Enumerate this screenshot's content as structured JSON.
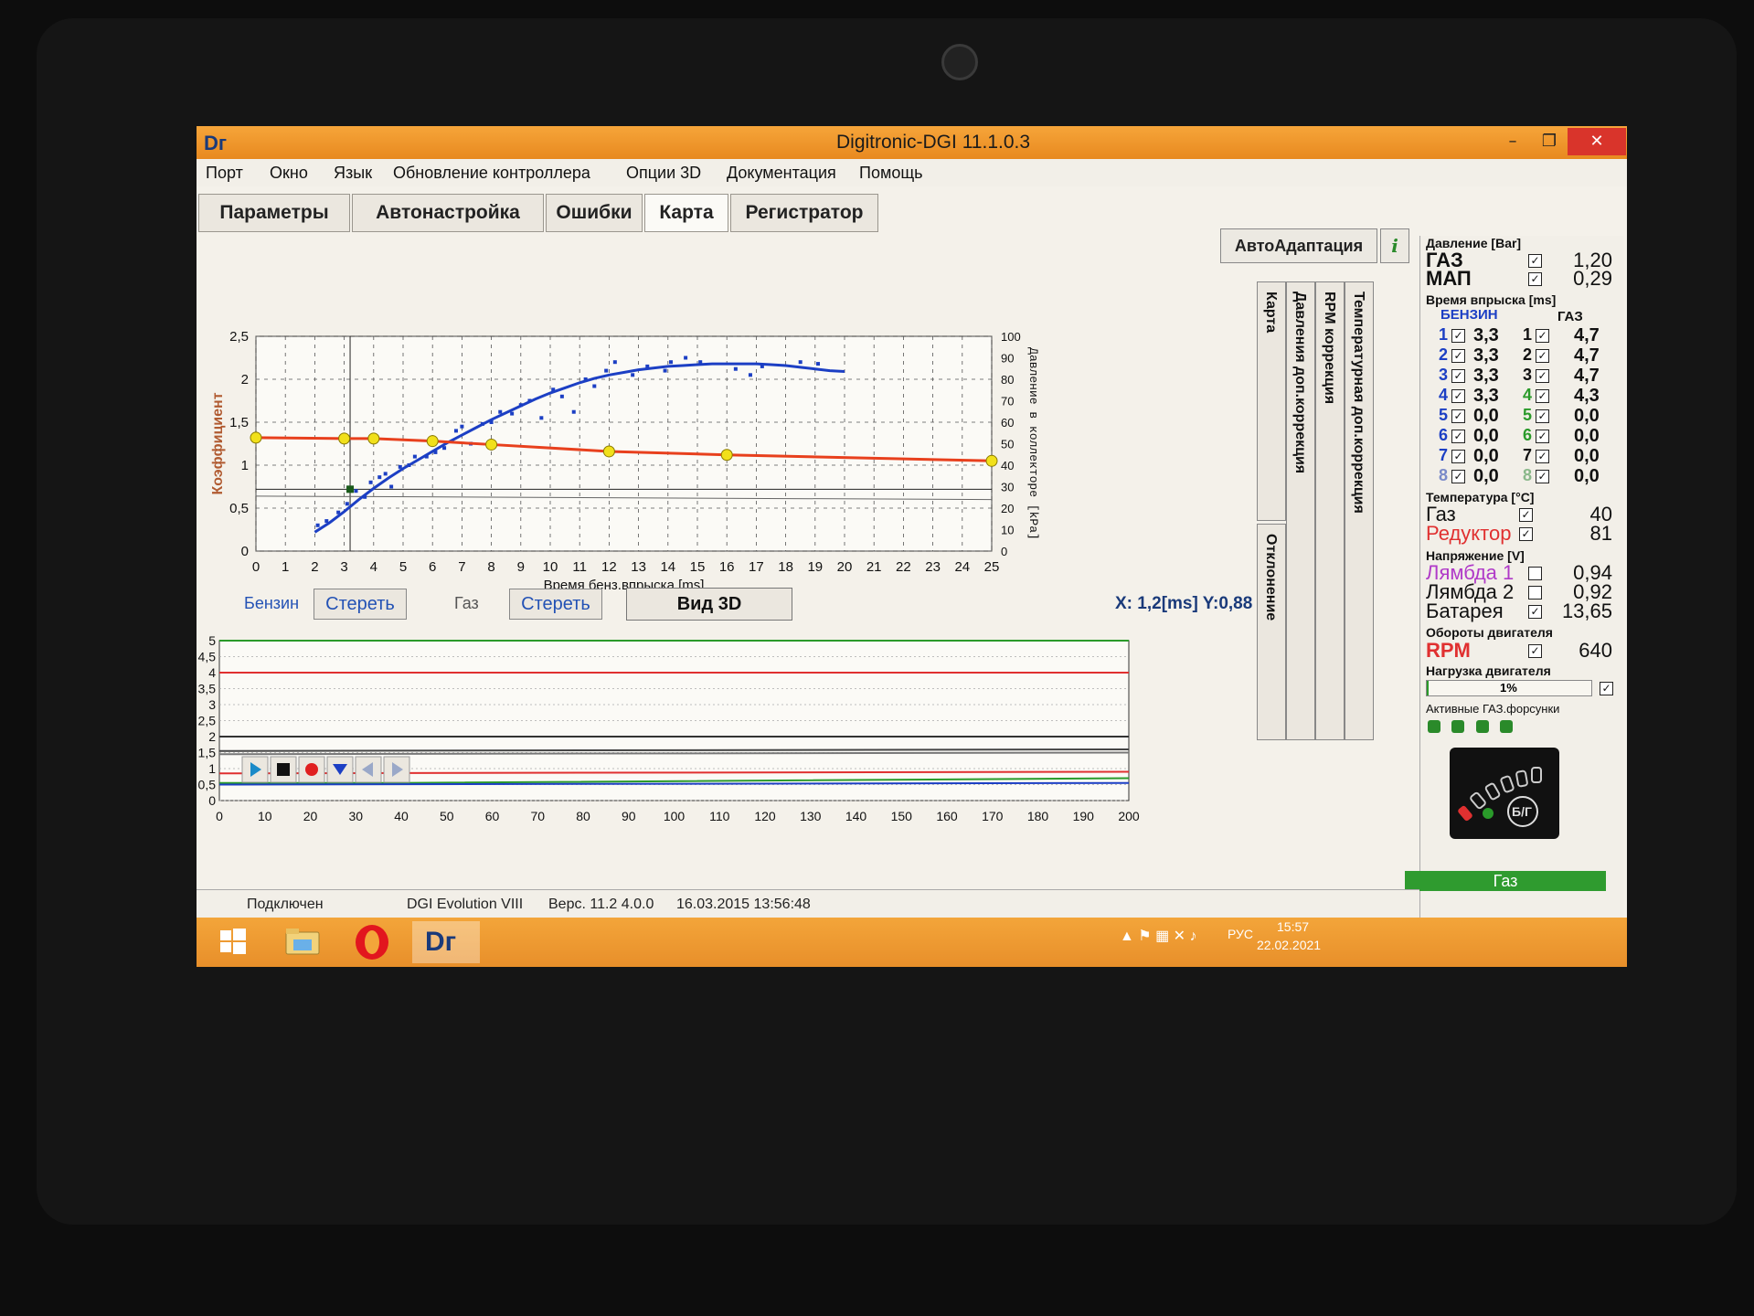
{
  "window": {
    "title": "Digitronic-DGI  11.1.0.3",
    "logo": "Dг",
    "minimize_icon": "minimize-icon",
    "restore_icon": "restore-icon",
    "close_icon": "close-icon"
  },
  "menu": [
    "Порт",
    "Окно",
    "Язык",
    "Обновление контроллера",
    "Опции 3D",
    "Документация",
    "Помощь"
  ],
  "tabs": [
    "Параметры",
    "Автонастройка",
    "Ошибки",
    "Карта",
    "Регистратор"
  ],
  "toolbar": {
    "auto_adapt": "АвтоАдаптация",
    "info": "i"
  },
  "main_chart_labels": {
    "ylabel": "Коэффициент",
    "xlabel": "Время бенз.впрыска [ms]",
    "y2label": "Давление в коллекторе [kPa]",
    "x_ticks": [
      "0",
      "1",
      "2",
      "3",
      "4",
      "5",
      "6",
      "7",
      "8",
      "9",
      "10",
      "11",
      "12",
      "13",
      "14",
      "15",
      "16",
      "17",
      "18",
      "19",
      "20",
      "21",
      "22",
      "23",
      "24",
      "25"
    ],
    "y_ticks": [
      "0",
      "0,5",
      "1",
      "1,5",
      "2",
      "2,5"
    ],
    "y2_ticks": [
      "0",
      "10",
      "20",
      "30",
      "40",
      "50",
      "60",
      "70",
      "80",
      "90",
      "100"
    ]
  },
  "vertical_tabs": [
    "Карта",
    "Отклонение",
    "Давления доп.коррекция",
    "RPM коррекция",
    "Температурная доп.коррекция"
  ],
  "controls": {
    "petrol_label": "Бензин",
    "petrol_clear": "Стереть",
    "gas_label": "Газ",
    "gas_clear": "Стереть",
    "view3d": "Вид 3D",
    "coord_text": "X:  1,2[ms] Y:0,88"
  },
  "bottom_chart_labels": {
    "x_ticks": [
      "0",
      "10",
      "20",
      "30",
      "40",
      "50",
      "60",
      "70",
      "80",
      "90",
      "100",
      "110",
      "120",
      "130",
      "140",
      "150",
      "160",
      "170",
      "180",
      "190",
      "200"
    ],
    "y_ticks": [
      "0",
      "0,5",
      "1",
      "1,5",
      "2",
      "2,5",
      "3",
      "3,5",
      "4",
      "4,5",
      "5"
    ]
  },
  "player": [
    "play-icon",
    "stop-icon",
    "record-icon",
    "download-icon",
    "back-icon",
    "forward-icon"
  ],
  "panel": {
    "pressure": {
      "title": "Давление [Bar]",
      "rows": [
        {
          "label": "ГАЗ",
          "value": "1,20"
        },
        {
          "label": "МАП",
          "value": "0,29"
        }
      ]
    },
    "injection": {
      "title": "Время впрыска [ms]",
      "col_petrol": "БЕНЗИН",
      "col_gas": "ГАЗ",
      "rows": [
        {
          "p": "1",
          "pv": "3,3",
          "g": "1",
          "gv": "4,7"
        },
        {
          "p": "2",
          "pv": "3,3",
          "g": "2",
          "gv": "4,7"
        },
        {
          "p": "3",
          "pv": "3,3",
          "g": "3",
          "gv": "4,7"
        },
        {
          "p": "4",
          "pv": "3,3",
          "g": "4",
          "gv": "4,3"
        },
        {
          "p": "5",
          "pv": "0,0",
          "g": "5",
          "gv": "0,0"
        },
        {
          "p": "6",
          "pv": "0,0",
          "g": "6",
          "gv": "0,0"
        },
        {
          "p": "7",
          "pv": "0,0",
          "g": "7",
          "gv": "0,0"
        },
        {
          "p": "8",
          "pv": "0,0",
          "g": "8",
          "gv": "0,0"
        }
      ]
    },
    "temperature": {
      "title": "Температура [°C]",
      "rows": [
        {
          "label": "Газ",
          "value": "40"
        },
        {
          "label": "Редуктор",
          "value": "81"
        }
      ]
    },
    "voltage": {
      "title": "Напряжение [V]",
      "rows": [
        {
          "label": "Лямбда 1",
          "value": "0,94"
        },
        {
          "label": "Лямбда 2",
          "value": "0,92"
        },
        {
          "label": "Батарея",
          "value": "13,65"
        }
      ]
    },
    "rpm": {
      "title": "Обороты двигателя",
      "label": "RPM",
      "value": "640"
    },
    "load": {
      "title": "Нагрузка двигателя",
      "value": "1%"
    },
    "injectors": {
      "title": "Активные ГАЗ.форсунки",
      "count": 4
    },
    "switch_label": "Б/Г",
    "mode": "Газ"
  },
  "status": {
    "connection": "Подключен",
    "device": "DGI Evolution VIII",
    "version": "Верс. 11.2  4.0.0",
    "date": "16.03.2015 13:56:48"
  },
  "taskbar": {
    "apps": [
      "windows-start-icon",
      "file-explorer-icon",
      "opera-icon",
      "digitronic-icon"
    ],
    "dg_label": "Dг",
    "lang": "РУС",
    "time": "15:57",
    "date": "22.02.2021"
  },
  "chart_data": [
    {
      "type": "scatter",
      "title": "",
      "xlabel": "Время бенз.впрыска [ms]",
      "ylabel": "Коэффициент",
      "xlim": [
        0,
        25
      ],
      "ylim": [
        0,
        2.5
      ],
      "grid": true,
      "series": [
        {
          "name": "",
          "color": "#1c3fc4",
          "kind": "fit-line",
          "x": [
            2,
            2.5,
            3,
            3.5,
            4,
            4.5,
            5,
            5.5,
            6,
            6.5,
            7,
            7.5,
            8,
            8.5,
            9,
            9.5,
            10,
            10.5,
            11,
            11.5,
            12,
            12.5,
            13,
            13.5,
            14,
            14.5,
            15,
            15.5,
            16,
            16.5,
            17,
            17.5,
            18,
            18.5,
            19,
            19.5,
            20
          ],
          "y": [
            0.22,
            0.33,
            0.46,
            0.6,
            0.73,
            0.85,
            0.96,
            1.06,
            1.16,
            1.26,
            1.35,
            1.44,
            1.53,
            1.61,
            1.69,
            1.77,
            1.84,
            1.9,
            1.96,
            2.01,
            2.05,
            2.08,
            2.11,
            2.13,
            2.15,
            2.16,
            2.17,
            2.18,
            2.18,
            2.18,
            2.18,
            2.17,
            2.16,
            2.14,
            2.12,
            2.1,
            2.09
          ]
        },
        {
          "name": "",
          "color": "#1c3fc4",
          "kind": "points",
          "x": [
            2.1,
            2.4,
            2.8,
            3.1,
            3.4,
            3.7,
            3.9,
            4.2,
            4.4,
            4.6,
            4.9,
            5.2,
            5.4,
            5.8,
            6.1,
            6.4,
            6.8,
            7.0,
            7.3,
            7.7,
            8.0,
            8.3,
            8.7,
            9.0,
            9.3,
            9.7,
            10.1,
            10.4,
            10.8,
            11.2,
            11.5,
            11.9,
            12.2,
            12.8,
            13.3,
            13.9,
            14.1,
            14.6,
            15.1,
            16.3,
            16.8,
            17.2,
            18.5,
            19.1
          ],
          "y": [
            0.3,
            0.35,
            0.45,
            0.55,
            0.7,
            0.63,
            0.8,
            0.86,
            0.9,
            0.75,
            0.98,
            1.0,
            1.1,
            1.1,
            1.15,
            1.2,
            1.4,
            1.45,
            1.25,
            1.48,
            1.5,
            1.62,
            1.6,
            1.7,
            1.75,
            1.55,
            1.88,
            1.8,
            1.62,
            2.0,
            1.92,
            2.1,
            2.2,
            2.05,
            2.15,
            2.1,
            2.2,
            2.25,
            2.2,
            2.12,
            2.05,
            2.15,
            2.2,
            2.18
          ]
        },
        {
          "name": "",
          "color": "#e8401d",
          "kind": "line",
          "x": [
            0,
            3,
            4,
            6,
            8,
            12,
            16,
            25
          ],
          "y": [
            1.32,
            1.31,
            1.31,
            1.28,
            1.24,
            1.16,
            1.12,
            1.05
          ]
        }
      ]
    },
    {
      "type": "line",
      "title": "",
      "xlim": [
        0,
        200
      ],
      "ylim": [
        0,
        5
      ],
      "grid": true,
      "series": [
        {
          "name": "",
          "color": "#e03030",
          "x": [
            0,
            200
          ],
          "y": [
            4,
            4
          ]
        },
        {
          "name": "",
          "color": "#333333",
          "x": [
            0,
            200
          ],
          "y": [
            2,
            2
          ]
        },
        {
          "name": "",
          "color": "#444444",
          "x": [
            0,
            200
          ],
          "y": [
            1.55,
            1.6
          ]
        },
        {
          "name": "",
          "color": "#777777",
          "x": [
            0,
            200
          ],
          "y": [
            1.45,
            1.5
          ]
        },
        {
          "name": "",
          "color": "#e03030",
          "x": [
            0,
            200
          ],
          "y": [
            0.85,
            0.9
          ]
        },
        {
          "name": "",
          "color": "#2a9a2a",
          "x": [
            0,
            40,
            200
          ],
          "y": [
            0.55,
            0.55,
            0.7
          ]
        },
        {
          "name": "",
          "color": "#1c3fc4",
          "x": [
            0,
            200
          ],
          "y": [
            0.5,
            0.55
          ]
        },
        {
          "name": "",
          "color": "#2a9a2a",
          "x": [
            0,
            200
          ],
          "y": [
            5,
            5
          ]
        }
      ]
    }
  ]
}
